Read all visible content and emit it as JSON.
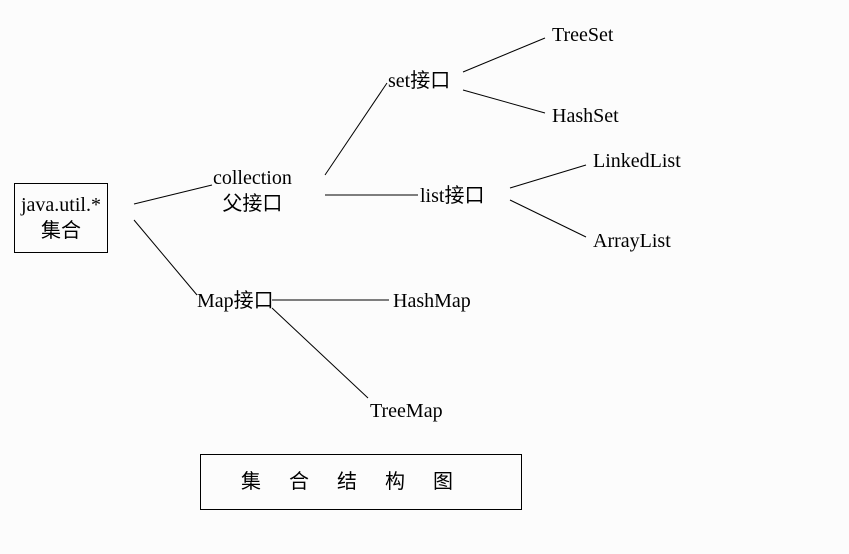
{
  "root": {
    "line1": "java.util.*",
    "line2": "集合"
  },
  "collection": {
    "line1": "collection",
    "line2": "父接口"
  },
  "set": "set接口",
  "list": "list接口",
  "map": "Map接口",
  "treeset": "TreeSet",
  "hashset": "HashSet",
  "linkedlist": "LinkedList",
  "arraylist": "ArrayList",
  "hashmap": "HashMap",
  "treemap": "TreeMap",
  "title": "集合结构图"
}
